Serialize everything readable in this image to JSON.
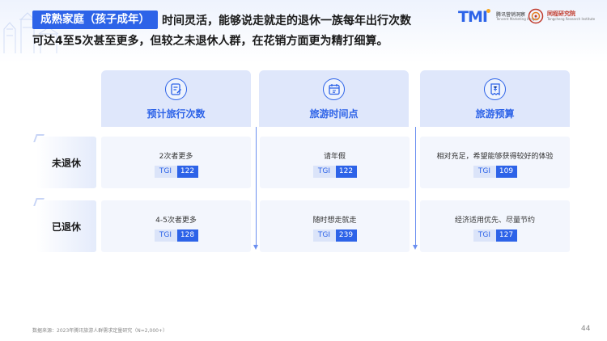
{
  "header": {
    "tag": "成熟家庭（孩子成年）",
    "line1": "时间灵活，能够说走就走的退休一族每年出行次数",
    "line2": "可达4至5次甚至更多，但较之未退休人群，在花销方面更为精打细算。"
  },
  "logos": {
    "tmi_mark": "TMI",
    "tmi_cn": "腾讯营销洞察",
    "tmi_en": "Tencent Marketing Insight",
    "ts_cn": "同程研究院",
    "ts_en": "Tongcheng Research Institute"
  },
  "columns": [
    {
      "label": "预计旅行次数",
      "icon": "document-edit-icon"
    },
    {
      "label": "旅游时间点",
      "icon": "calendar-clock-icon"
    },
    {
      "label": "旅游预算",
      "icon": "receipt-yuan-icon"
    }
  ],
  "rows": [
    {
      "label": "未退休",
      "cells": [
        {
          "text": "2次者更多",
          "tgi_label": "TGI",
          "tgi_value": "122"
        },
        {
          "text": "请年假",
          "tgi_label": "TGI",
          "tgi_value": "122"
        },
        {
          "text": "相对充足，希望能够获得较好的体验",
          "tgi_label": "TGI",
          "tgi_value": "109"
        }
      ]
    },
    {
      "label": "已退休",
      "cells": [
        {
          "text": "4-5次者更多",
          "tgi_label": "TGI",
          "tgi_value": "128"
        },
        {
          "text": "随时想走就走",
          "tgi_label": "TGI",
          "tgi_value": "239"
        },
        {
          "text": "经济适用优先、尽量节约",
          "tgi_label": "TGI",
          "tgi_value": "127"
        }
      ]
    }
  ],
  "footer": {
    "source": "数据来源：2023年腾讯旅游人群需求定量研究（N=2,000+）",
    "page_number": "44"
  },
  "colors": {
    "accent": "#2d63e8",
    "header_fill": "#dfe7fb",
    "cell_fill": "#f3f6fd",
    "seal_red": "#c0392b"
  }
}
